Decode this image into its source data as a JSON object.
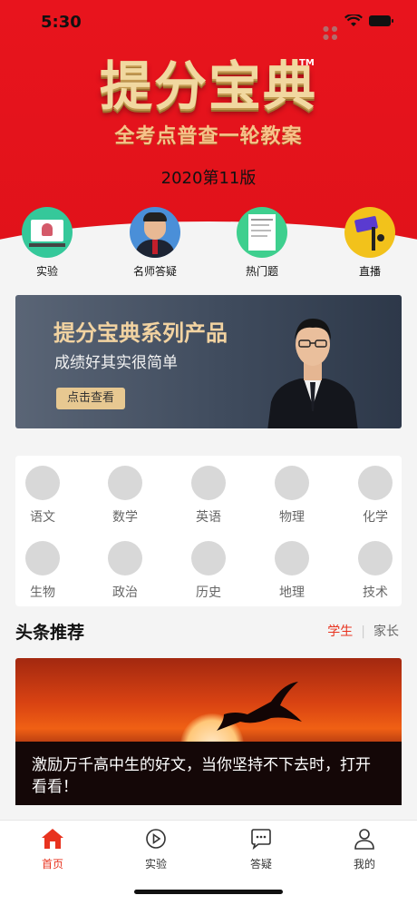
{
  "status": {
    "time": "5:30"
  },
  "brand": {
    "title": "提分宝典",
    "trademark": "TM",
    "subtitle": "全考点普查一轮教案",
    "edition": "2020第11版"
  },
  "quick_actions": [
    {
      "label": "实验",
      "icon": "experiment-video-thumbnail",
      "color": "#35c89a"
    },
    {
      "label": "名师答疑",
      "icon": "teacher-portrait",
      "color": "#4a8fd8"
    },
    {
      "label": "热门题",
      "icon": "exam-paper-thumbnail",
      "color": "#3ecf8e"
    },
    {
      "label": "直播",
      "icon": "phone-tripod-icon",
      "color": "#f2c21b"
    }
  ],
  "banner": {
    "title": "提分宝典系列产品",
    "subtitle": "成绩好其实很简单",
    "button": "点击查看"
  },
  "subjects": [
    {
      "label": "语文",
      "icon": "chinese-icon"
    },
    {
      "label": "数学",
      "icon": "math-icon"
    },
    {
      "label": "英语",
      "icon": "english-icon"
    },
    {
      "label": "物理",
      "icon": "physics-icon"
    },
    {
      "label": "化学",
      "icon": "chemistry-icon"
    },
    {
      "label": "生物",
      "icon": "biology-icon"
    },
    {
      "label": "政治",
      "icon": "politics-icon"
    },
    {
      "label": "历史",
      "icon": "history-icon"
    },
    {
      "label": "地理",
      "icon": "geography-icon"
    },
    {
      "label": "技术",
      "icon": "technology-icon"
    }
  ],
  "headlines": {
    "title": "头条推荐",
    "tabs": [
      "学生",
      "家长"
    ],
    "active_tab": "学生",
    "article": {
      "caption": "激励万千高中生的好文，当你坚持不下去时，打开看看！"
    }
  },
  "tabbar": [
    {
      "label": "首页",
      "icon": "home-icon",
      "active": true
    },
    {
      "label": "实验",
      "icon": "play-circle-icon",
      "active": false
    },
    {
      "label": "答疑",
      "icon": "chat-bubble-icon",
      "active": false
    },
    {
      "label": "我的",
      "icon": "user-icon",
      "active": false
    }
  ],
  "colors": {
    "brand_red": "#e8141d",
    "accent_red": "#e8331f",
    "gold": "#e7c891"
  }
}
